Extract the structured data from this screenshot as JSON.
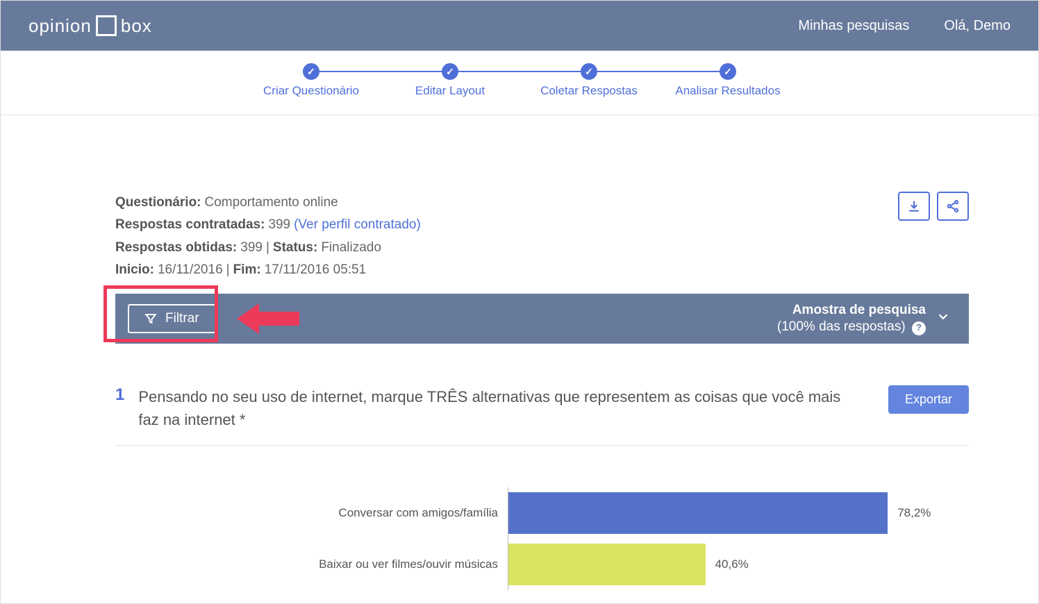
{
  "header": {
    "logo_left": "opinion",
    "logo_right": "box",
    "nav_my_surveys": "Minhas pesquisas",
    "greeting": "Olá, Demo"
  },
  "steps": [
    {
      "label": "Criar Questionário"
    },
    {
      "label": "Editar Layout"
    },
    {
      "label": "Coletar Respostas"
    },
    {
      "label": "Analisar Resultados"
    }
  ],
  "meta": {
    "questionnaire_label": "Questionário:",
    "questionnaire_value": "Comportamento online",
    "contracted_label": "Respostas contratadas:",
    "contracted_value": "399",
    "view_profile": "(Ver perfil contratado)",
    "obtained_label": "Respostas obtidas:",
    "obtained_value": "399",
    "status_label": "Status:",
    "status_value": "Finalizado",
    "start_label": "Inicio:",
    "start_value": "16/11/2016",
    "end_label": "Fim:",
    "end_value": "17/11/2016 05:51"
  },
  "filter": {
    "button": "Filtrar",
    "sample_title": "Amostra de pesquisa",
    "sample_subtitle": "(100% das respostas)"
  },
  "question": {
    "number": "1",
    "text": "Pensando no seu uso de internet, marque TRÊS alternativas que representem as coisas que você mais faz na internet *",
    "export_button": "Exportar"
  },
  "chart_data": {
    "type": "bar",
    "orientation": "horizontal",
    "title": "",
    "xlabel": "",
    "ylabel": "",
    "categories": [
      "Conversar com amigos/família",
      "Baixar ou ver filmes/ouvir músicas"
    ],
    "values": [
      78.2,
      40.6
    ],
    "value_labels": [
      "78,2%",
      "40,6%"
    ],
    "colors": [
      "#5572c9",
      "#dbe362"
    ],
    "xlim": [
      0,
      100
    ]
  }
}
